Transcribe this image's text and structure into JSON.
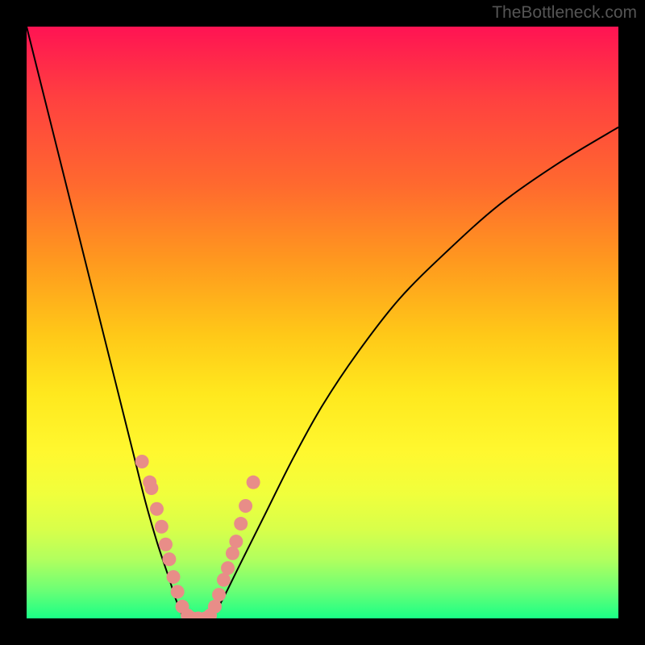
{
  "watermark": "TheBottleneck.com",
  "chart_data": {
    "type": "line",
    "title": "",
    "xlabel": "",
    "ylabel": "",
    "xlim": [
      0,
      100
    ],
    "ylim": [
      0,
      100
    ],
    "series": [
      {
        "name": "curve-left",
        "color": "#000000",
        "x": [
          0,
          2,
          4,
          6,
          8,
          10,
          12,
          14,
          16,
          18,
          20,
          22,
          24,
          25.5,
          27
        ],
        "y": [
          100,
          92,
          84,
          76,
          68,
          60,
          52,
          44,
          36,
          28,
          20,
          13,
          7,
          2.5,
          0
        ]
      },
      {
        "name": "curve-flat",
        "color": "#000000",
        "x": [
          27,
          31
        ],
        "y": [
          0,
          0
        ]
      },
      {
        "name": "curve-right",
        "color": "#000000",
        "x": [
          31,
          33,
          36,
          40,
          45,
          50,
          56,
          63,
          71,
          80,
          90,
          100
        ],
        "y": [
          0,
          3,
          9,
          17,
          27,
          36,
          45,
          54,
          62,
          70,
          77,
          83
        ]
      }
    ],
    "points": {
      "name": "data-points",
      "color": "#e88d88",
      "x": [
        19.5,
        20.8,
        21.1,
        22.0,
        22.8,
        23.5,
        24.1,
        24.8,
        25.5,
        26.3,
        27.2,
        28.0,
        29.0,
        30.2,
        31.0,
        31.8,
        32.5,
        33.3,
        34.0,
        34.8,
        35.4,
        36.2,
        37.0,
        38.3
      ],
      "y": [
        26.5,
        23.0,
        22.0,
        18.5,
        15.5,
        12.5,
        10.0,
        7.0,
        4.5,
        2.0,
        0.5,
        0.0,
        0.0,
        0.0,
        0.5,
        2.0,
        4.0,
        6.5,
        8.5,
        11.0,
        13.0,
        16.0,
        19.0,
        23.0
      ]
    }
  }
}
